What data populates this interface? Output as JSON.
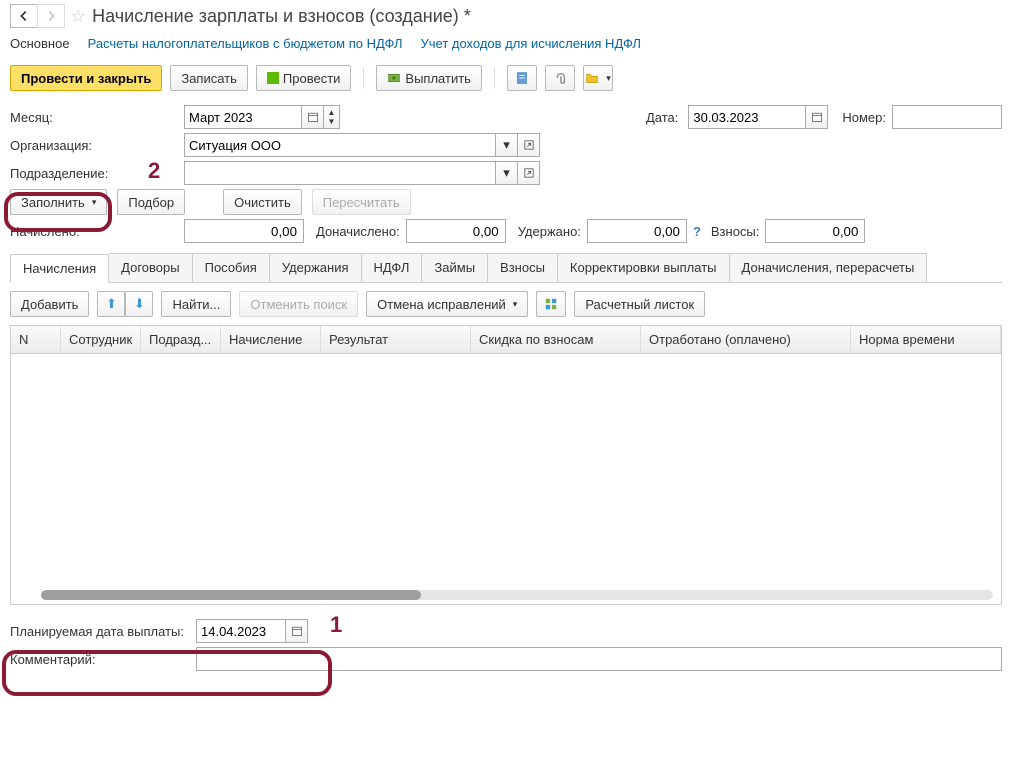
{
  "header": {
    "title": "Начисление зарплаты и взносов (создание) *"
  },
  "links": {
    "main": "Основное",
    "ndfl_calc": "Расчеты налогоплательщиков с бюджетом по НДФЛ",
    "ndfl_income": "Учет доходов для исчисления НДФЛ"
  },
  "toolbar": {
    "post_close": "Провести и закрыть",
    "write": "Записать",
    "post": "Провести",
    "pay": "Выплатить"
  },
  "form": {
    "month_lbl": "Месяц:",
    "month_val": "Март 2023",
    "date_lbl": "Дата:",
    "date_val": "30.03.2023",
    "number_lbl": "Номер:",
    "number_val": "",
    "org_lbl": "Организация:",
    "org_val": "Ситуация ООО",
    "dept_lbl": "Подразделение:",
    "dept_val": "",
    "fill_btn": "Заполнить",
    "pick_btn": "Подбор",
    "clear_btn": "Очистить",
    "recalc_btn": "Пересчитать",
    "accrued_lbl": "Начислено:",
    "accrued_val": "0,00",
    "addl_lbl": "Доначислено:",
    "addl_val": "0,00",
    "withheld_lbl": "Удержано:",
    "withheld_val": "0,00",
    "contrib_lbl": "Взносы:",
    "contrib_val": "0,00"
  },
  "tabs": [
    "Начисления",
    "Договоры",
    "Пособия",
    "Удержания",
    "НДФЛ",
    "Займы",
    "Взносы",
    "Корректировки выплаты",
    "Доначисления, перерасчеты"
  ],
  "subtoolbar": {
    "add": "Добавить",
    "find": "Найти...",
    "cancel_search": "Отменить поиск",
    "cancel_fix": "Отмена исправлений",
    "payslip": "Расчетный листок"
  },
  "columns": [
    "N",
    "Сотрудник",
    "Подразд...",
    "Начисление",
    "Результат",
    "Скидка по взносам",
    "Отработано (оплачено)",
    "Норма времени"
  ],
  "bottom": {
    "plan_date_lbl": "Планируемая дата выплаты:",
    "plan_date_val": "14.04.2023",
    "comment_lbl": "Комментарий:",
    "comment_val": ""
  },
  "annotations": {
    "n1": "1",
    "n2": "2"
  }
}
